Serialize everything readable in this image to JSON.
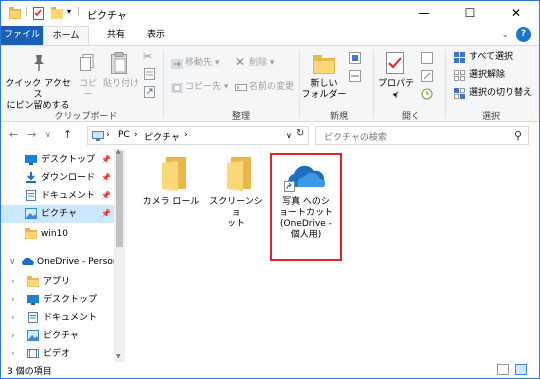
{
  "window": {
    "title": "ピクチャ",
    "controls": {
      "minimize": "—",
      "maximize": "☐",
      "close": "✕"
    }
  },
  "ribbon_tabs": [
    "ファイル",
    "ホーム",
    "共有",
    "表示"
  ],
  "ribbon": {
    "clipboard": {
      "pin_label_1": "クイック アクセス",
      "pin_label_2": "にピン留めする",
      "copy": "コピー",
      "paste": "貼り付け",
      "group": "クリップボード"
    },
    "organize": {
      "move_to": "移動先",
      "copy_to": "コピー先",
      "delete": "削除",
      "rename": "名前の変更",
      "group": "整理"
    },
    "new": {
      "new_folder_1": "新しい",
      "new_folder_2": "フォルダー",
      "group": "新規"
    },
    "open": {
      "properties": "プロパティ",
      "group": "開く"
    },
    "select": {
      "select_all": "すべて選択",
      "select_none": "選択解除",
      "invert": "選択の切り替え",
      "group": "選択"
    }
  },
  "address": {
    "crumbs": [
      "PC",
      "ピクチャ"
    ],
    "search_placeholder": "ピクチャの検索"
  },
  "nav": {
    "quick_access": [
      {
        "label": "デスクトップ",
        "icon": "desktop-icon",
        "pinned": true
      },
      {
        "label": "ダウンロード",
        "icon": "download-icon",
        "pinned": true
      },
      {
        "label": "ドキュメント",
        "icon": "document-icon",
        "pinned": true
      },
      {
        "label": "ピクチャ",
        "icon": "pictures-icon",
        "pinned": true,
        "selected": true
      },
      {
        "label": "win10",
        "icon": "folder-icon",
        "pinned": false
      }
    ],
    "onedrive_label": "OneDrive - Persor",
    "onedrive_items": [
      "アプリ",
      "デスクトップ",
      "ドキュメント",
      "ピクチャ",
      "ビデオ"
    ]
  },
  "content": {
    "items": [
      {
        "label": "カメラ ロール",
        "type": "folder"
      },
      {
        "label_lines": [
          "スクリーンショ",
          "ット"
        ],
        "type": "folder"
      },
      {
        "label_lines": [
          "写真 へのシ",
          "ョートカット",
          "(OneDrive -",
          "個人用)"
        ],
        "type": "shortcut"
      }
    ]
  },
  "status": {
    "text": "3 個の項目"
  },
  "colors": {
    "accent": "#1a5fb4",
    "highlight": "#e0242a",
    "selected": "#cce8ff"
  }
}
